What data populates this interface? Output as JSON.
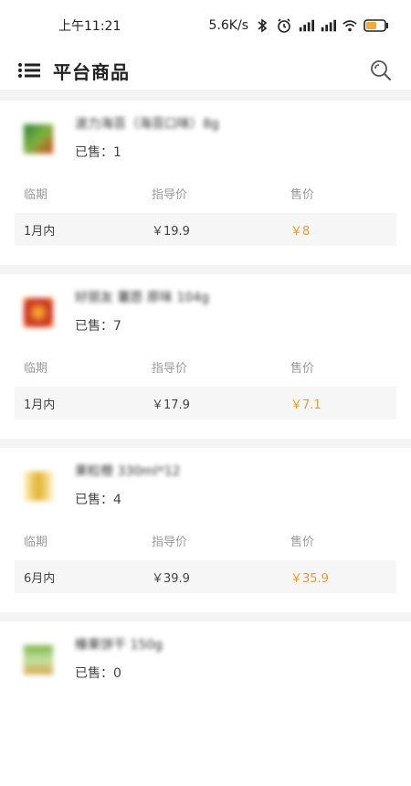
{
  "status_bar": {
    "time": "上午11:21",
    "network_speed": "5.6K/s"
  },
  "header": {
    "title": "平台商品"
  },
  "labels": {
    "expiry": "临期",
    "guide_price": "指导价",
    "sale_price": "售价",
    "sold_prefix": "已售："
  },
  "products": [
    {
      "name": "波力海苔（海苔口味）8g",
      "sold": "1",
      "expiry_value": "1月内",
      "guide_price": "￥19.9",
      "sale_price": "￥8",
      "thumb_color": "#4caf50"
    },
    {
      "name": "好丽友 薯愿 原味 104g",
      "sold": "7",
      "expiry_value": "1月内",
      "guide_price": "￥17.9",
      "sale_price": "￥7.1",
      "thumb_color": "#c0392b"
    },
    {
      "name": "果粒橙 330ml*12",
      "sold": "4",
      "expiry_value": "6月内",
      "guide_price": "￥39.9",
      "sale_price": "￥35.9",
      "thumb_color": "#e6c84f"
    },
    {
      "name": "榛果饼干 150g",
      "sold": "0",
      "thumb_color": "#8bc34a"
    }
  ]
}
